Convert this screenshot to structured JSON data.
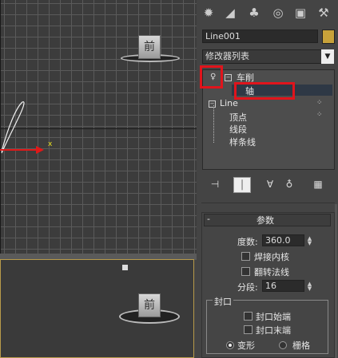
{
  "viewport_top": {
    "cube_label": "前",
    "axis_label": "x"
  },
  "viewport_bottom": {
    "cube_label": "前"
  },
  "command_panel": {
    "tabs": [
      "create-tab",
      "modify-tab",
      "hierarchy-tab",
      "motion-tab",
      "display-tab",
      "utilities-tab"
    ],
    "object_name": "Line001",
    "object_color": "#c8a23a",
    "modifier_list_label": "修改器列表",
    "stack": {
      "modifier": "车削",
      "sub_axis": "轴",
      "base_object": "Line",
      "sub_items": [
        "顶点",
        "线段",
        "样条线"
      ]
    }
  },
  "parameters": {
    "rollout_title": "参数",
    "degrees_label": "度数:",
    "degrees_value": "360.0",
    "weld_core_label": "焊接内核",
    "flip_normals_label": "翻转法线",
    "segments_label": "分段:",
    "segments_value": "16",
    "capping_group_label": "封口",
    "cap_start_label": "封口始端",
    "cap_end_label": "封口末端",
    "morph_label": "变形",
    "grid_label": "栅格"
  }
}
